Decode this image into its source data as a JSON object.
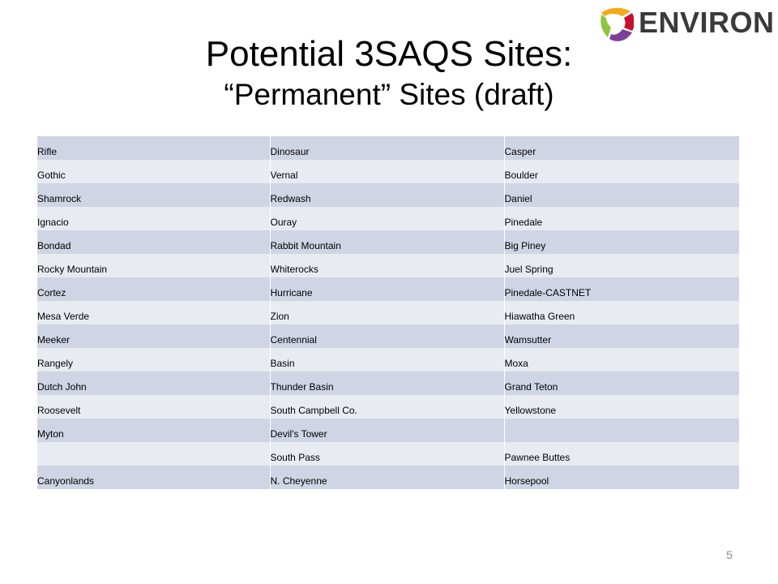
{
  "logo": {
    "text": "ENVIRON",
    "mark_colors": [
      "#f4a81c",
      "#8dc63f",
      "#7b3f98",
      "#c8102e"
    ]
  },
  "title": {
    "line1": "Potential 3SAQS Sites:",
    "line2": "“Permanent” Sites (draft)"
  },
  "table": {
    "rows": [
      [
        "Rifle",
        "Dinosaur",
        "Casper"
      ],
      [
        "Gothic",
        "Vernal",
        "Boulder"
      ],
      [
        "Shamrock",
        "Redwash",
        "Daniel"
      ],
      [
        "Ignacio",
        "Ouray",
        "Pinedale"
      ],
      [
        "Bondad",
        "Rabbit Mountain",
        "Big Piney"
      ],
      [
        "Rocky Mountain",
        "Whiterocks",
        "Juel Spring"
      ],
      [
        "Cortez",
        "Hurricane",
        "Pinedale-CASTNET"
      ],
      [
        "Mesa Verde",
        "Zion",
        "Hiawatha Green"
      ],
      [
        "Meeker",
        "Centennial",
        "Wamsutter"
      ],
      [
        "Rangely",
        "Basin",
        "Moxa"
      ],
      [
        "Dutch John",
        "Thunder Basin",
        "Grand Teton"
      ],
      [
        "Roosevelt",
        "South Campbell Co.",
        "Yellowstone"
      ],
      [
        "Myton",
        "Devil's Tower",
        ""
      ],
      [
        "",
        "South Pass",
        "Pawnee Buttes"
      ],
      [
        "Canyonlands",
        "N. Cheyenne",
        "Horsepool"
      ]
    ],
    "row_colors": {
      "odd": "#cfd5e4",
      "even": "#e8ebf2"
    }
  },
  "page_number": "5"
}
